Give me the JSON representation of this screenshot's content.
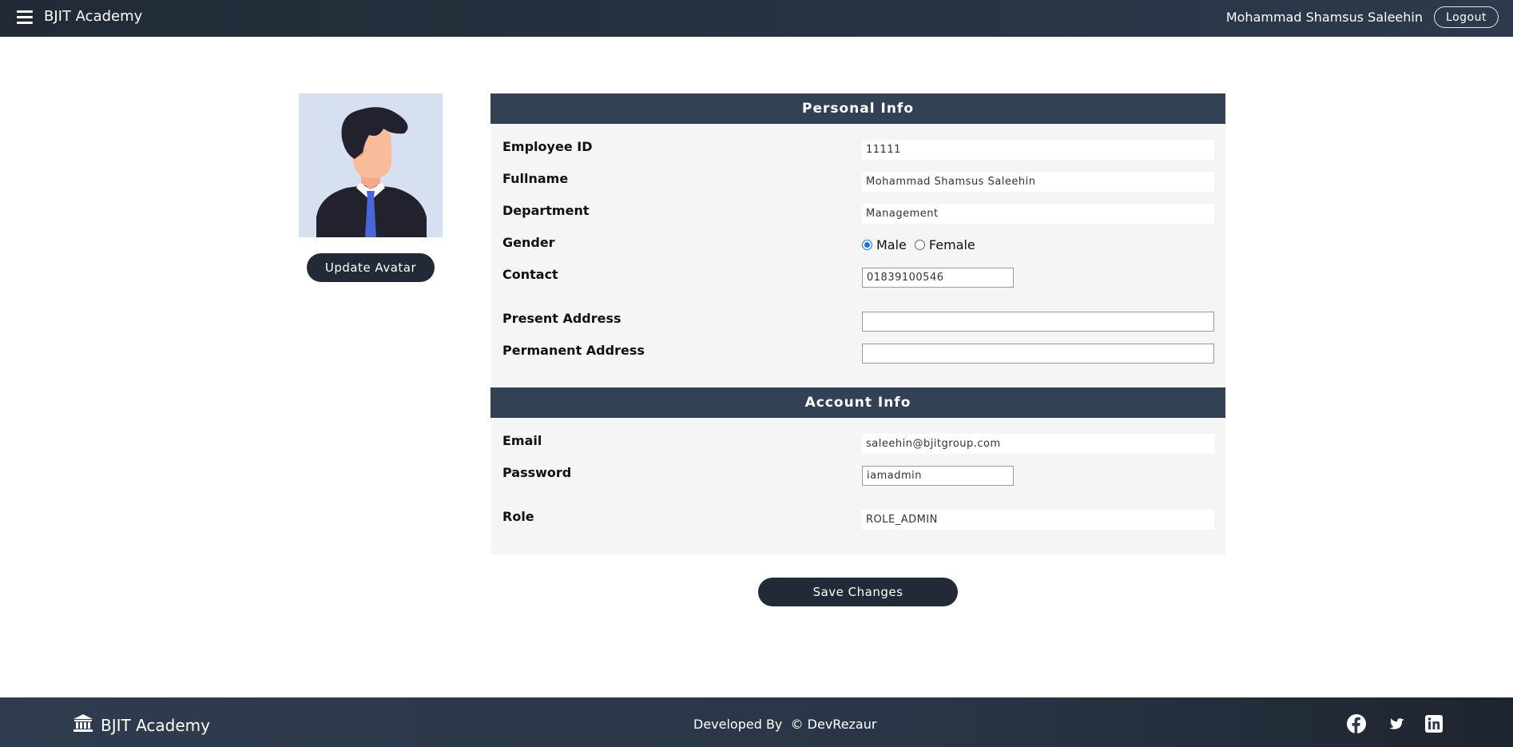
{
  "navbar": {
    "brand": "BJIT Academy",
    "user_name": "Mohammad Shamsus Saleehin",
    "logout_label": "Logout"
  },
  "avatar": {
    "update_label": "Update Avatar",
    "icon": "user-avatar-illustration"
  },
  "personal_info": {
    "header": "Personal Info",
    "employee_id_label": "Employee ID",
    "employee_id": "11111",
    "fullname_label": "Fullname",
    "fullname": "Mohammad Shamsus Saleehin",
    "department_label": "Department",
    "department": "Management",
    "gender_label": "Gender",
    "gender_options": [
      "Male",
      "Female"
    ],
    "gender_selected": "Male",
    "contact_label": "Contact",
    "contact": "01839100546",
    "present_address_label": "Present Address",
    "present_address": "",
    "permanent_address_label": "Permanent Address",
    "permanent_address": ""
  },
  "account_info": {
    "header": "Account Info",
    "email_label": "Email",
    "email": "saleehin@bjitgroup.com",
    "password_label": "Password",
    "password": "iamadmin",
    "role_label": "Role",
    "role": "ROLE_ADMIN"
  },
  "actions": {
    "save_label": "Save Changes"
  },
  "footer": {
    "brand": "BJIT Academy",
    "credit": "Developed By  © DevRezaur"
  },
  "colors": {
    "navbar": "#212a36",
    "panel_header": "#334155",
    "button": "#212a36",
    "panel_bg": "#f5f5f5",
    "radio_accent": "#1a73e8"
  }
}
